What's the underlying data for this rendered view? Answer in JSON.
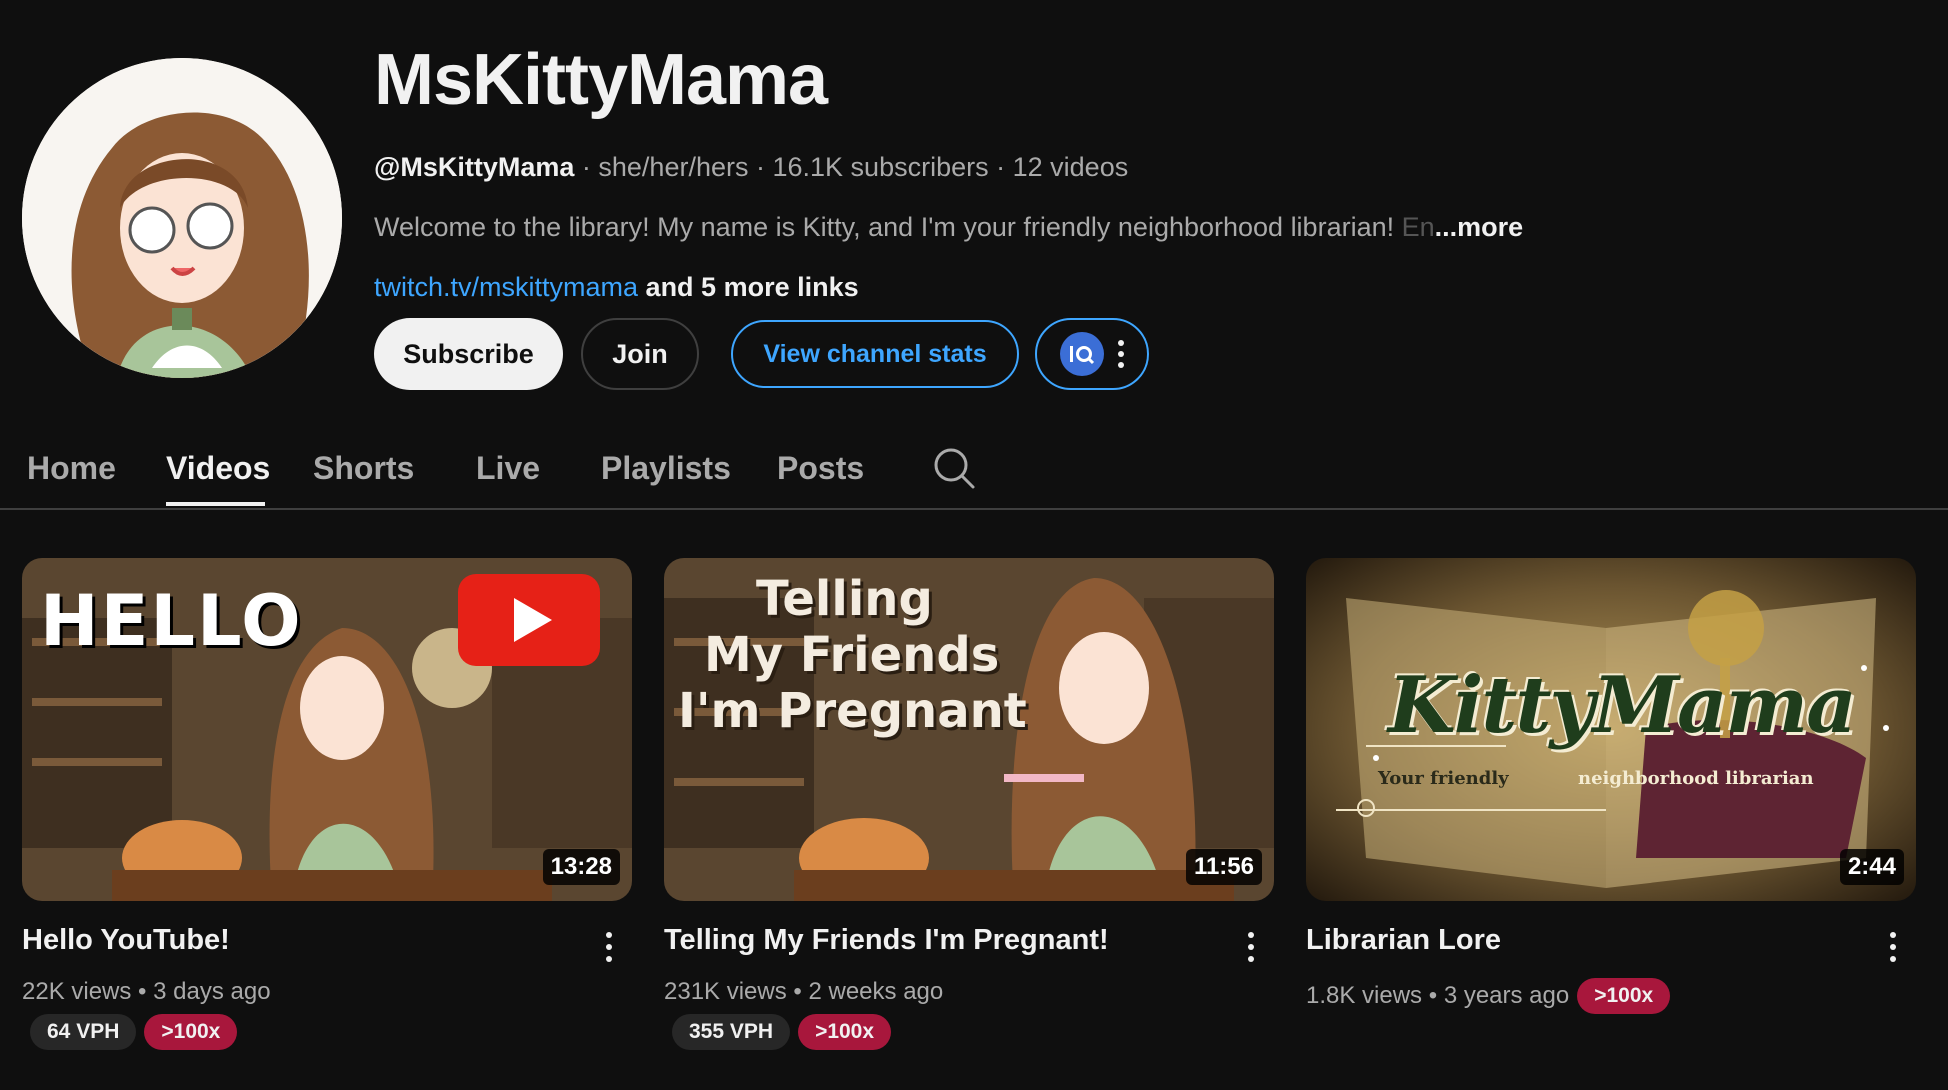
{
  "channel": {
    "name": "MsKittyMama",
    "handle": "@MsKittyMama",
    "pronouns": "she/her/hers",
    "subscribers": "16.1K subscribers",
    "video_count": "12 videos",
    "description": "Welcome to the library!  My name is Kitty, and I'm your friendly neighborhood librarian!",
    "description_fade": "En",
    "more_label": "...more",
    "link": "twitch.tv/mskittymama",
    "more_links": "and 5 more links"
  },
  "buttons": {
    "subscribe": "Subscribe",
    "join": "Join",
    "view_stats": "View channel stats",
    "extension_icon": "vidiq-icon"
  },
  "tabs": [
    {
      "label": "Home",
      "active": false
    },
    {
      "label": "Videos",
      "active": true
    },
    {
      "label": "Shorts",
      "active": false
    },
    {
      "label": "Live",
      "active": false
    },
    {
      "label": "Playlists",
      "active": false
    },
    {
      "label": "Posts",
      "active": false
    }
  ],
  "videos": [
    {
      "title": "Hello YouTube!",
      "views": "22K views",
      "age": "3 days ago",
      "duration": "13:28",
      "vph": "64 VPH",
      "multiplier": ">100x",
      "thumb_text": "HELLO"
    },
    {
      "title": "Telling My Friends I'm Pregnant!",
      "views": "231K views",
      "age": "2 weeks ago",
      "duration": "11:56",
      "vph": "355 VPH",
      "multiplier": ">100x",
      "thumb_text": [
        "Telling",
        "My Friends",
        "I'm Pregnant"
      ]
    },
    {
      "title": "Librarian Lore",
      "views": "1.8K views",
      "age": "3 years ago",
      "duration": "2:44",
      "multiplier": ">100x",
      "thumb_text": [
        "KittyMama",
        "Your friendly",
        "neighborhood librarian"
      ]
    }
  ],
  "colors": {
    "background": "#0f0f0f",
    "link": "#3ea6ff",
    "multiplier_badge": "#a8173c",
    "vph_badge": "#272727"
  }
}
